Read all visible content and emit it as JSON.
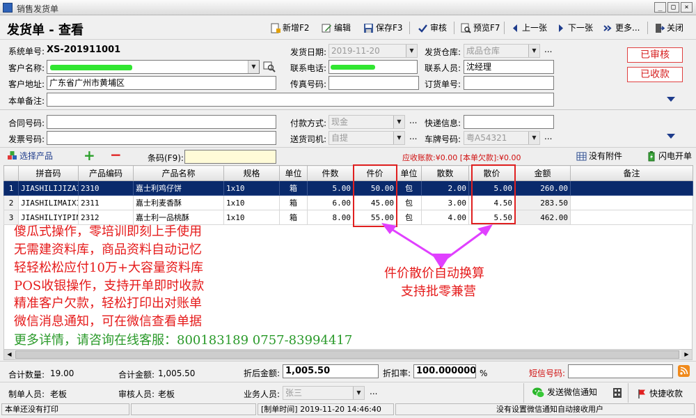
{
  "window": {
    "title": "销售发货单",
    "min_glyph": "_",
    "max_glyph": "□",
    "close_glyph": "×"
  },
  "header": {
    "page_title": "发货单 - 查看"
  },
  "toolbar": {
    "new": "新增F2",
    "edit": "编辑",
    "save": "保存F3",
    "approve": "审核",
    "preview": "预览F7",
    "prev": "上一张",
    "next": "下一张",
    "more": "更多...",
    "close": "关闭"
  },
  "form": {
    "sysno_label": "系统单号:",
    "sysno_value": "XS-201911001",
    "ship_date_label": "发货日期:",
    "ship_date_value": "2019-11-20",
    "warehouse_label": "发货仓库:",
    "warehouse_value": "成品仓库",
    "customer_label": "客户名称:",
    "customer_value": "",
    "phone_label": "联系电话:",
    "phone_value": "",
    "contact_label": "联系人员:",
    "contact_value": "沈经理",
    "address_label": "客户地址:",
    "address_value": "广东省广州市黄埔区",
    "fax_label": "传真号码:",
    "fax_value": "",
    "order_no_label": "订货单号:",
    "order_no_value": "",
    "remark_label": "本单备注:",
    "remark_value": "",
    "contract_label": "合同号码:",
    "contract_value": "",
    "pay_label": "付款方式:",
    "pay_value": "现金",
    "express_label": "快递信息:",
    "express_value": "",
    "invoice_label": "发票号码:",
    "invoice_value": "",
    "driver_label": "送货司机:",
    "driver_value": "自提",
    "plate_label": "车牌号码:",
    "plate_value": "粤A54321",
    "dots": "...",
    "stamp_approved": "已审核",
    "stamp_paid": "已收款"
  },
  "product_bar": {
    "select_label": "选择产品",
    "add_glyph": "+",
    "remove_glyph": "−",
    "barcode_label": "条码(F9):",
    "barcode_value": "",
    "balance_text": "应收账款:¥0.00 [本单欠款]:¥0.00",
    "attach_label": "没有附件",
    "flash_label": "闪电开单"
  },
  "table": {
    "columns": [
      "",
      "拼音码",
      "产品编码",
      "产品名称",
      "规格",
      "单位",
      "件数",
      "件价",
      "单位",
      "散数",
      "散价",
      "金额",
      "备注"
    ],
    "rows": [
      {
        "no": "1",
        "pinyin": "JIASHILIJIZAIB",
        "code": "2310",
        "name": "嘉士利鸡仔饼",
        "spec": "1x10",
        "unit": "箱",
        "qty": "5.00",
        "price": "50.00",
        "unit2": "包",
        "loose_qty": "2.00",
        "loose_price": "5.00",
        "amount": "260.00",
        "note": ""
      },
      {
        "no": "2",
        "pinyin": "JIASHILIMAIXI",
        "code": "2311",
        "name": "嘉士利麦香酥",
        "spec": "1x10",
        "unit": "箱",
        "qty": "6.00",
        "price": "45.00",
        "unit2": "包",
        "loose_qty": "3.00",
        "loose_price": "4.50",
        "amount": "283.50",
        "note": ""
      },
      {
        "no": "3",
        "pinyin": "JIASHILIYIPIN",
        "code": "2312",
        "name": "嘉士利一品桃酥",
        "spec": "1x10",
        "unit": "箱",
        "qty": "8.00",
        "price": "55.00",
        "unit2": "包",
        "loose_qty": "4.00",
        "loose_price": "5.50",
        "amount": "462.00",
        "note": ""
      }
    ]
  },
  "promo": {
    "lines": [
      "傻瓜式操作，零培训即刻上手使用",
      "无需建资料库，商品资料自动记忆",
      "轻轻松松应付10万+大容量资料库",
      "POS收银操作，支持开单即时收款",
      "精准客户欠款，轻松打印出对账单",
      "微信消息通知，可在微信查看单据"
    ],
    "contact_line": "更多详情，请咨询在线客服：800183189  0757-83994417",
    "callout_line1": "件价散价自动换算",
    "callout_line2": "支持批零兼营"
  },
  "footer": {
    "total_qty_label": "合计数量:",
    "total_qty_value": "19.00",
    "total_amount_label": "合计金额:",
    "total_amount_value": "1,005.50",
    "discount_amount_label": "折后金额:",
    "discount_amount_value": "1,005.50",
    "discount_rate_label": "折扣率:",
    "discount_rate_value": "100.000000",
    "percent": "%",
    "sms_label": "短信号码:",
    "sms_value": "",
    "maker_label": "制单人员:",
    "maker_value": "老板",
    "approver_label": "审核人员:",
    "approver_value": "老板",
    "sales_label": "业务人员:",
    "sales_value": "张三",
    "wechat_label": "发送微信通知",
    "quick_pay_label": "快捷收款"
  },
  "statusbar": {
    "print_status": "本单还没有打印",
    "created_time": "[制单时间] 2019-11-20 14:46:40",
    "wechat_status": "没有设置微信通知自动接收用户"
  },
  "colors": {
    "accent_red": "#e51a1a",
    "selection_navy": "#0a2a6c",
    "callout_magenta": "#e040ff",
    "balance_red": "#d01010"
  }
}
